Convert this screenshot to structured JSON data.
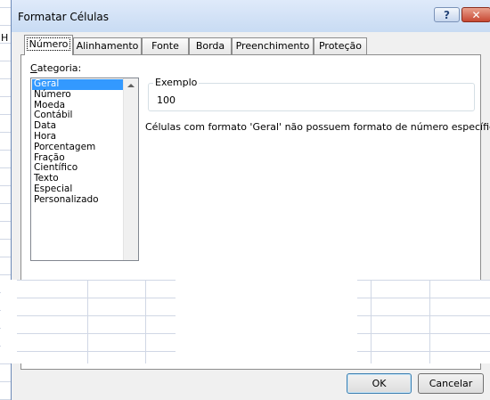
{
  "background": {
    "column_letter": "H"
  },
  "dialog": {
    "title": "Formatar Células",
    "help_label": "?",
    "close_label": "✕"
  },
  "tabs": [
    {
      "label": "Número",
      "active": true
    },
    {
      "label": "Alinhamento"
    },
    {
      "label": "Fonte"
    },
    {
      "label": "Borda"
    },
    {
      "label": "Preenchimento"
    },
    {
      "label": "Proteção"
    }
  ],
  "category": {
    "label_accel": "C",
    "label_rest": "ategoria:",
    "items": [
      "Geral",
      "Número",
      "Moeda",
      "Contábil",
      "Data",
      "Hora",
      "Porcentagem",
      "Fração",
      "Científico",
      "Texto",
      "Especial",
      "Personalizado"
    ],
    "selected": "Geral"
  },
  "sample": {
    "legend": "Exemplo",
    "value": "100"
  },
  "description": "Células com formato 'Geral' não possuem formato de número específico.",
  "buttons": {
    "ok": "OK",
    "cancel": "Cancelar"
  },
  "colors": {
    "selection": "#3399ff",
    "titlebar": "#c8dbf3",
    "close": "#c74833"
  }
}
